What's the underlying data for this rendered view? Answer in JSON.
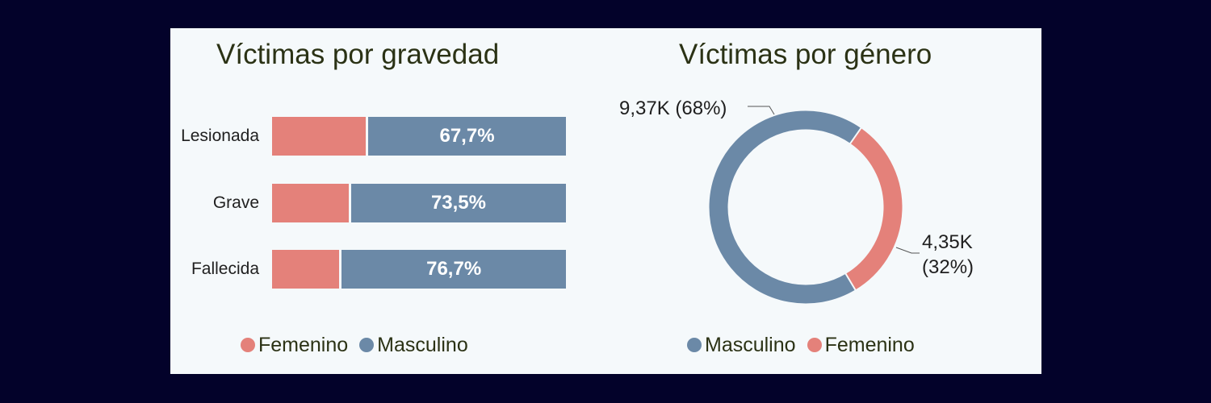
{
  "left_chart": {
    "title": "Víctimas por gravedad",
    "legend": [
      {
        "label": "Femenino",
        "color": "#e4817a"
      },
      {
        "label": "Masculino",
        "color": "#6b89a7"
      }
    ]
  },
  "right_chart": {
    "title": "Víctimas por género",
    "legend": [
      {
        "label": "Masculino",
        "color": "#6b89a7"
      },
      {
        "label": "Femenino",
        "color": "#e4817a"
      }
    ],
    "label_masculino": "9,37K (68%)",
    "label_femenino_line1": "4,35K",
    "label_femenino_line2": "(32%)"
  },
  "chart_data": [
    {
      "type": "bar",
      "orientation": "horizontal",
      "stacked": "100%",
      "title": "Víctimas por gravedad",
      "categories": [
        "Lesionada",
        "Grave",
        "Fallecida"
      ],
      "series": [
        {
          "name": "Femenino",
          "values": [
            32.3,
            26.5,
            23.3
          ],
          "color": "#e4817a"
        },
        {
          "name": "Masculino",
          "values": [
            67.7,
            73.5,
            76.7
          ],
          "color": "#6b89a7"
        }
      ],
      "data_labels": [
        "67,7%",
        "73,5%",
        "76,7%"
      ],
      "legend_position": "bottom"
    },
    {
      "type": "pie",
      "style": "donut",
      "title": "Víctimas por género",
      "slices": [
        {
          "name": "Masculino",
          "value": 9370,
          "percent": 68,
          "label": "9,37K (68%)",
          "color": "#6b89a7"
        },
        {
          "name": "Femenino",
          "value": 4350,
          "percent": 32,
          "label": "4,35K (32%)",
          "color": "#e4817a"
        }
      ],
      "legend_position": "bottom"
    }
  ]
}
